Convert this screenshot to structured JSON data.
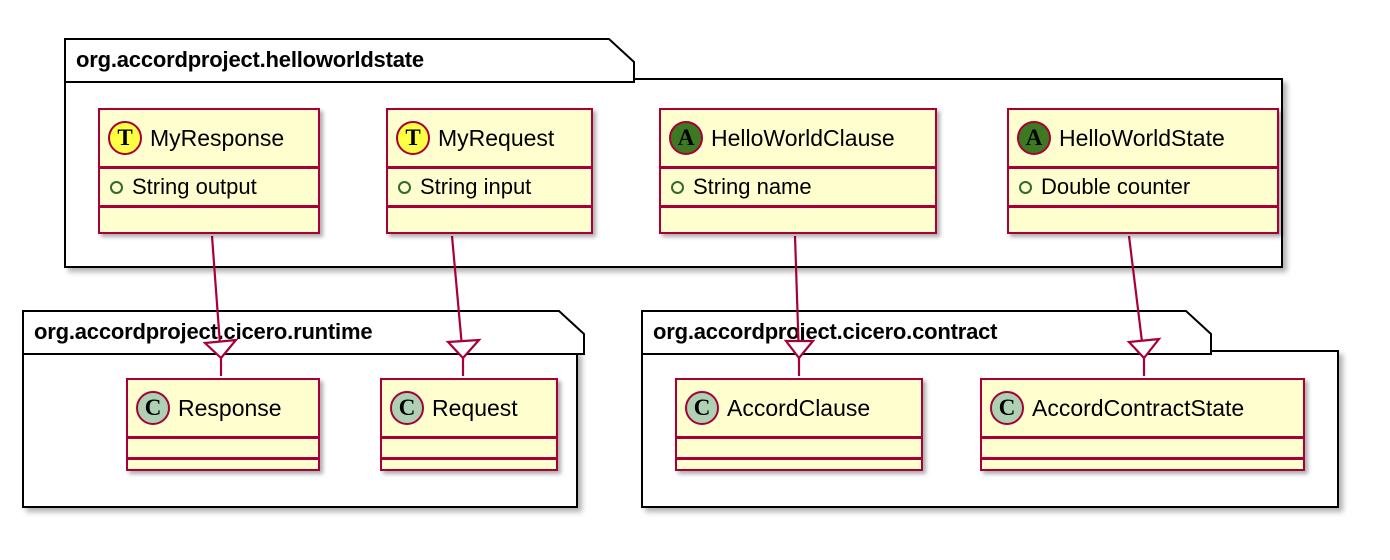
{
  "diagram": {
    "kind": "uml-class-diagram",
    "background": "#FFFFFF",
    "colors": {
      "class_border": "#A80036",
      "class_fill": "#FEFECE",
      "package_border": "#000000",
      "package_fill": "#FFFFFF",
      "arrow": "#A80036",
      "badge_type": "#FFFF44",
      "badge_abstract": "#3B7A21",
      "badge_class": "#ADD1B2",
      "visibility_public": "#2F6B2F"
    }
  },
  "packages": [
    {
      "id": "helloworldstate",
      "name": "org.accordproject.helloworldstate",
      "classes": [
        {
          "id": "MyResponse",
          "name": "MyResponse",
          "stereotype_letter": "T",
          "stereotype_kind": "transaction",
          "attributes": [
            {
              "visibility": "public",
              "text": "String output"
            }
          ],
          "methods": []
        },
        {
          "id": "MyRequest",
          "name": "MyRequest",
          "stereotype_letter": "T",
          "stereotype_kind": "transaction",
          "attributes": [
            {
              "visibility": "public",
              "text": "String input"
            }
          ],
          "methods": []
        },
        {
          "id": "HelloWorldClause",
          "name": "HelloWorldClause",
          "stereotype_letter": "A",
          "stereotype_kind": "abstract",
          "attributes": [
            {
              "visibility": "public",
              "text": "String name"
            }
          ],
          "methods": []
        },
        {
          "id": "HelloWorldState",
          "name": "HelloWorldState",
          "stereotype_letter": "A",
          "stereotype_kind": "abstract",
          "attributes": [
            {
              "visibility": "public",
              "text": "Double counter"
            }
          ],
          "methods": []
        }
      ]
    },
    {
      "id": "cicero-runtime",
      "name": "org.accordproject.cicero.runtime",
      "classes": [
        {
          "id": "Response",
          "name": "Response",
          "stereotype_letter": "C",
          "stereotype_kind": "class",
          "attributes": [],
          "methods": []
        },
        {
          "id": "Request",
          "name": "Request",
          "stereotype_letter": "C",
          "stereotype_kind": "class",
          "attributes": [],
          "methods": []
        }
      ]
    },
    {
      "id": "cicero-contract",
      "name": "org.accordproject.cicero.contract",
      "classes": [
        {
          "id": "AccordClause",
          "name": "AccordClause",
          "stereotype_letter": "C",
          "stereotype_kind": "class",
          "attributes": [],
          "methods": []
        },
        {
          "id": "AccordContractState",
          "name": "AccordContractState",
          "stereotype_letter": "C",
          "stereotype_kind": "class",
          "attributes": [],
          "methods": []
        }
      ]
    }
  ],
  "relationships": [
    {
      "id": "rel-1",
      "type": "inheritance",
      "from": "MyResponse",
      "to": "Response"
    },
    {
      "id": "rel-2",
      "type": "inheritance",
      "from": "MyRequest",
      "to": "Request"
    },
    {
      "id": "rel-3",
      "type": "inheritance",
      "from": "HelloWorldClause",
      "to": "AccordClause"
    },
    {
      "id": "rel-4",
      "type": "inheritance",
      "from": "HelloWorldState",
      "to": "AccordContractState"
    }
  ]
}
